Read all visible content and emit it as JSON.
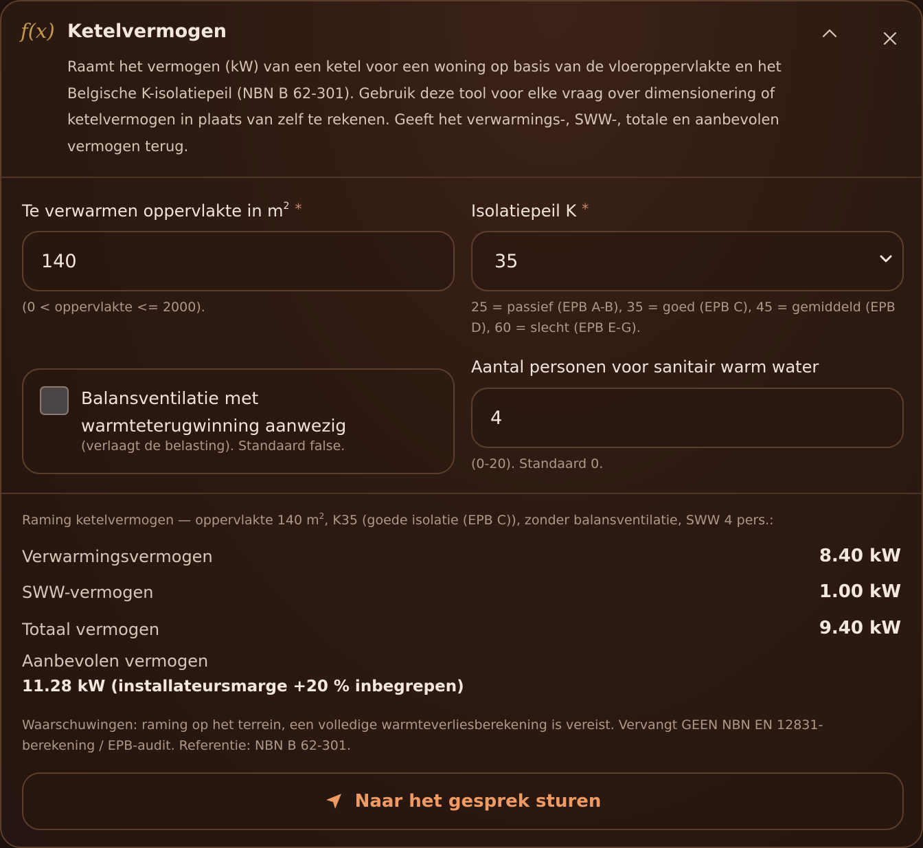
{
  "header": {
    "fx_label": "f(x)",
    "title": "Ketelvermogen",
    "description": "Raamt het vermogen (kW) van een ketel voor een woning op basis van de vloeroppervlakte en het Belgische K-isolatiepeil (NBN B 62-301). Gebruik deze tool voor elke vraag over dimensionering of ketelvermogen in plaats van zelf te rekenen. Geeft het verwarmings-, SWW-, totale en aanbevolen vermogen terug.",
    "collapse_icon": "chevron-up-icon",
    "close_icon": "close-icon"
  },
  "form": {
    "area": {
      "label": "Te verwarmen oppervlakte in m",
      "label_sup": "2",
      "required_mark": "*",
      "value": "140",
      "help": "(0 < oppervlakte <= 2000)."
    },
    "insulation": {
      "label": "Isolatiepeil K",
      "required_mark": "*",
      "value": "35",
      "help": "25 = passief (EPB A-B), 35 = goed (EPB C), 45 = gemiddeld (EPB D), 60 = slecht (EPB E-G)."
    },
    "ventilation": {
      "label": "Balansventilatie met warmteterugwinning aanwezig",
      "help": "(verlaagt de belasting). Standaard false.",
      "checked": false
    },
    "persons": {
      "label": "Aantal personen voor sanitair warm water",
      "value": "4",
      "help": "(0-20). Standaard 0."
    }
  },
  "result": {
    "summary_pre": "Raming ketelvermogen — oppervlakte 140 m",
    "summary_sup": "2",
    "summary_post": ", K35 (goede isolatie (EPB C)), zonder balansventilatie, SWW 4 pers.:",
    "heating_label": "Verwarmingsvermogen",
    "heating_value": "8.40 kW",
    "dhw_label": "SWW-vermogen",
    "dhw_value": "1.00 kW",
    "total_label": "Totaal vermogen",
    "total_value": "9.40 kW",
    "recommended_label": "Aanbevolen vermogen",
    "recommended_value": "11.28 kW (installateursmarge +20 % inbegrepen)",
    "warnings": "Waarschuwingen: raming op het terrein, een volledige warmteverliesberekening is vereist. Vervangt GEEN NBN EN 12831-berekening / EPB-audit. Referentie: NBN B 62-301."
  },
  "send_button": {
    "label": "Naar het gesprek sturen",
    "icon": "send-icon"
  },
  "colors": {
    "accent": "#ef9a62",
    "fx": "#c59a4e",
    "background": "#2d1a12"
  }
}
